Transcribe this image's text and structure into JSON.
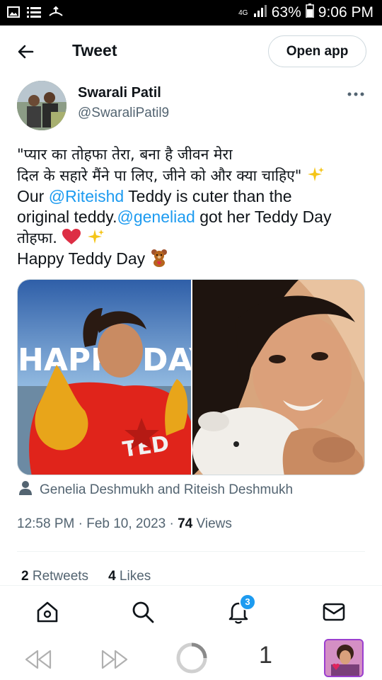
{
  "status_bar": {
    "network": "4G",
    "battery": "63%",
    "time": "9:06 PM"
  },
  "header": {
    "title": "Tweet",
    "open_app_label": "Open app"
  },
  "author": {
    "name": "Swarali Patil",
    "handle": "@SwaraliPatil9"
  },
  "tweet": {
    "line1": "\"प्यार का तोहफा तेरा, बना है जीवन मेरा",
    "line2": "दिल के सहारे मैंने पा लिए, जीने को और क्या चाहिए\"",
    "line3_prefix": "Our ",
    "mention1": "@Riteishd",
    "line3_suffix": " Teddy is cuter than the",
    "line4_prefix": "original teddy.",
    "mention2": "@geneliad",
    "line4_suffix": " got her Teddy Day",
    "line5": "तोहफा.",
    "line6": "Happy Teddy Day",
    "media_text_happy": "HAPPY",
    "media_text_day": "DAY"
  },
  "tagged_people": "Genelia Deshmukh and Riteish Deshmukh",
  "meta": {
    "time": "12:58 PM",
    "date": "Feb 10, 2023",
    "views_count": "74",
    "views_label": "Views"
  },
  "stats": {
    "retweets_count": "2",
    "retweets_label": "Retweets",
    "likes_count": "4",
    "likes_label": "Likes"
  },
  "bottom_nav": {
    "notifications_badge": "3",
    "icons": [
      "home-icon",
      "search-icon",
      "notifications-icon",
      "messages-icon"
    ]
  },
  "browser": {
    "tab_count": "1"
  },
  "colors": {
    "accent": "#1d9bf0",
    "text": "#0f1419",
    "secondary": "#536471"
  }
}
